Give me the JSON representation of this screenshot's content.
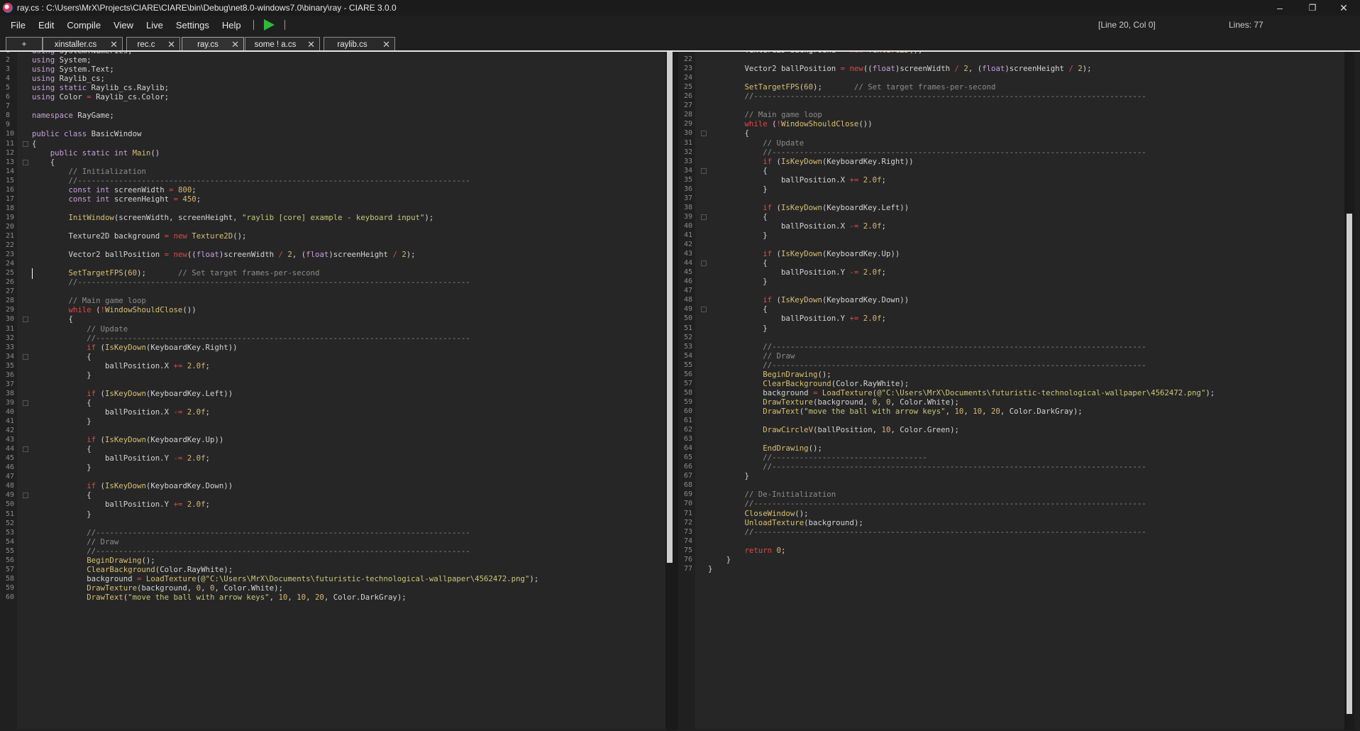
{
  "window": {
    "title": "ray.cs : C:\\Users\\MrX\\Projects\\CIARE\\CIARE\\bin\\Debug\\net8.0-windows7.0\\binary\\ray - CIARE 3.0.0",
    "minimize_glyph": "–",
    "maximize_glyph": "❐",
    "close_glyph": "✕"
  },
  "menu": {
    "items": [
      "File",
      "Edit",
      "Compile",
      "View",
      "Live",
      "Settings",
      "Help"
    ],
    "cursor_position": "[Line 20, Col 0]",
    "line_count": "Lines: 77"
  },
  "tabs": [
    {
      "label": "+",
      "active": false,
      "closable": false
    },
    {
      "label": "xinstaller.cs",
      "active": false,
      "closable": true
    },
    {
      "label": "rec.c",
      "active": false,
      "closable": true
    },
    {
      "label": "ray.cs",
      "active": true,
      "closable": true
    },
    {
      "label": "some ! a.cs",
      "active": false,
      "closable": true
    },
    {
      "label": "raylib.cs",
      "active": false,
      "closable": true
    }
  ],
  "tab_close_glyph": "✕",
  "editor": {
    "language": "C#",
    "lines": [
      "using System.Numerics;",
      "using System;",
      "using System.Text;",
      "using Raylib_cs;",
      "using static Raylib_cs.Raylib;",
      "using Color = Raylib_cs.Color;",
      "",
      "namespace RayGame;",
      "",
      "public class BasicWindow",
      "{",
      "    public static int Main()",
      "    {",
      "        // Initialization",
      "        //--------------------------------------------------------------------------------------",
      "        const int screenWidth = 800;",
      "        const int screenHeight = 450;",
      "",
      "        InitWindow(screenWidth, screenHeight, \"raylib [core] example - keyboard input\");",
      "",
      "        Texture2D background = new Texture2D();",
      "",
      "        Vector2 ballPosition = new((float)screenWidth / 2, (float)screenHeight / 2);",
      "",
      "        SetTargetFPS(60);       // Set target frames-per-second",
      "        //--------------------------------------------------------------------------------------",
      "",
      "        // Main game loop",
      "        while (!WindowShouldClose())",
      "        {",
      "            // Update",
      "            //----------------------------------------------------------------------------------",
      "            if (IsKeyDown(KeyboardKey.Right))",
      "            {",
      "                ballPosition.X += 2.0f;",
      "            }",
      "",
      "            if (IsKeyDown(KeyboardKey.Left))",
      "            {",
      "                ballPosition.X -= 2.0f;",
      "            }",
      "",
      "            if (IsKeyDown(KeyboardKey.Up))",
      "            {",
      "                ballPosition.Y -= 2.0f;",
      "            }",
      "",
      "            if (IsKeyDown(KeyboardKey.Down))",
      "            {",
      "                ballPosition.Y += 2.0f;",
      "            }",
      "",
      "            //----------------------------------------------------------------------------------",
      "            // Draw",
      "            //----------------------------------------------------------------------------------",
      "            BeginDrawing();",
      "            ClearBackground(Color.RayWhite);",
      "            background = LoadTexture(@\"C:\\Users\\MrX\\Documents\\futuristic-technological-wallpaper\\4562472.png\");",
      "            DrawTexture(background, 0, 0, Color.White);",
      "            DrawText(\"move the ball with arrow keys\", 10, 10, 20, Color.DarkGray);",
      "",
      "            DrawCircleV(ballPosition, 10, Color.Green);",
      "",
      "            EndDrawing();",
      "            //----------------------------------",
      "            //----------------------------------------------------------------------------------",
      "        }",
      "",
      "        // De-Initialization",
      "        //--------------------------------------------------------------------------------------",
      "        CloseWindow();",
      "        UnloadTexture(background);",
      "        //--------------------------------------------------------------------------------------",
      "",
      "        return 0;",
      "    }",
      "}"
    ],
    "left_pane": {
      "first_line": 1,
      "last_line": 60
    },
    "right_pane": {
      "first_line": 21,
      "last_line": 77
    },
    "fold_lines": [
      11,
      13,
      30,
      34,
      39,
      44,
      49
    ]
  }
}
